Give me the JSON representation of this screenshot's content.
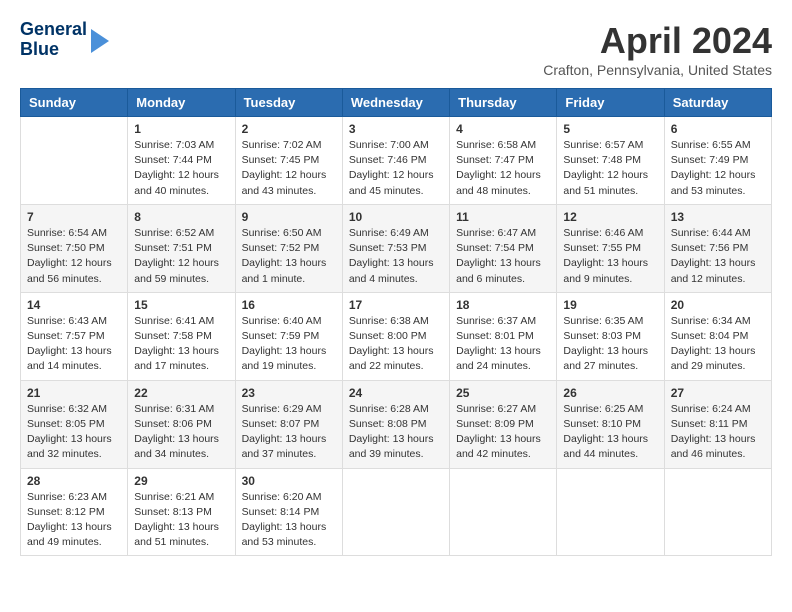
{
  "header": {
    "logo_line1": "General",
    "logo_line2": "Blue",
    "title": "April 2024",
    "subtitle": "Crafton, Pennsylvania, United States"
  },
  "days_of_week": [
    "Sunday",
    "Monday",
    "Tuesday",
    "Wednesday",
    "Thursday",
    "Friday",
    "Saturday"
  ],
  "weeks": [
    [
      {
        "day": "",
        "sunrise": "",
        "sunset": "",
        "daylight": ""
      },
      {
        "day": "1",
        "sunrise": "Sunrise: 7:03 AM",
        "sunset": "Sunset: 7:44 PM",
        "daylight": "Daylight: 12 hours and 40 minutes."
      },
      {
        "day": "2",
        "sunrise": "Sunrise: 7:02 AM",
        "sunset": "Sunset: 7:45 PM",
        "daylight": "Daylight: 12 hours and 43 minutes."
      },
      {
        "day": "3",
        "sunrise": "Sunrise: 7:00 AM",
        "sunset": "Sunset: 7:46 PM",
        "daylight": "Daylight: 12 hours and 45 minutes."
      },
      {
        "day": "4",
        "sunrise": "Sunrise: 6:58 AM",
        "sunset": "Sunset: 7:47 PM",
        "daylight": "Daylight: 12 hours and 48 minutes."
      },
      {
        "day": "5",
        "sunrise": "Sunrise: 6:57 AM",
        "sunset": "Sunset: 7:48 PM",
        "daylight": "Daylight: 12 hours and 51 minutes."
      },
      {
        "day": "6",
        "sunrise": "Sunrise: 6:55 AM",
        "sunset": "Sunset: 7:49 PM",
        "daylight": "Daylight: 12 hours and 53 minutes."
      }
    ],
    [
      {
        "day": "7",
        "sunrise": "Sunrise: 6:54 AM",
        "sunset": "Sunset: 7:50 PM",
        "daylight": "Daylight: 12 hours and 56 minutes."
      },
      {
        "day": "8",
        "sunrise": "Sunrise: 6:52 AM",
        "sunset": "Sunset: 7:51 PM",
        "daylight": "Daylight: 12 hours and 59 minutes."
      },
      {
        "day": "9",
        "sunrise": "Sunrise: 6:50 AM",
        "sunset": "Sunset: 7:52 PM",
        "daylight": "Daylight: 13 hours and 1 minute."
      },
      {
        "day": "10",
        "sunrise": "Sunrise: 6:49 AM",
        "sunset": "Sunset: 7:53 PM",
        "daylight": "Daylight: 13 hours and 4 minutes."
      },
      {
        "day": "11",
        "sunrise": "Sunrise: 6:47 AM",
        "sunset": "Sunset: 7:54 PM",
        "daylight": "Daylight: 13 hours and 6 minutes."
      },
      {
        "day": "12",
        "sunrise": "Sunrise: 6:46 AM",
        "sunset": "Sunset: 7:55 PM",
        "daylight": "Daylight: 13 hours and 9 minutes."
      },
      {
        "day": "13",
        "sunrise": "Sunrise: 6:44 AM",
        "sunset": "Sunset: 7:56 PM",
        "daylight": "Daylight: 13 hours and 12 minutes."
      }
    ],
    [
      {
        "day": "14",
        "sunrise": "Sunrise: 6:43 AM",
        "sunset": "Sunset: 7:57 PM",
        "daylight": "Daylight: 13 hours and 14 minutes."
      },
      {
        "day": "15",
        "sunrise": "Sunrise: 6:41 AM",
        "sunset": "Sunset: 7:58 PM",
        "daylight": "Daylight: 13 hours and 17 minutes."
      },
      {
        "day": "16",
        "sunrise": "Sunrise: 6:40 AM",
        "sunset": "Sunset: 7:59 PM",
        "daylight": "Daylight: 13 hours and 19 minutes."
      },
      {
        "day": "17",
        "sunrise": "Sunrise: 6:38 AM",
        "sunset": "Sunset: 8:00 PM",
        "daylight": "Daylight: 13 hours and 22 minutes."
      },
      {
        "day": "18",
        "sunrise": "Sunrise: 6:37 AM",
        "sunset": "Sunset: 8:01 PM",
        "daylight": "Daylight: 13 hours and 24 minutes."
      },
      {
        "day": "19",
        "sunrise": "Sunrise: 6:35 AM",
        "sunset": "Sunset: 8:03 PM",
        "daylight": "Daylight: 13 hours and 27 minutes."
      },
      {
        "day": "20",
        "sunrise": "Sunrise: 6:34 AM",
        "sunset": "Sunset: 8:04 PM",
        "daylight": "Daylight: 13 hours and 29 minutes."
      }
    ],
    [
      {
        "day": "21",
        "sunrise": "Sunrise: 6:32 AM",
        "sunset": "Sunset: 8:05 PM",
        "daylight": "Daylight: 13 hours and 32 minutes."
      },
      {
        "day": "22",
        "sunrise": "Sunrise: 6:31 AM",
        "sunset": "Sunset: 8:06 PM",
        "daylight": "Daylight: 13 hours and 34 minutes."
      },
      {
        "day": "23",
        "sunrise": "Sunrise: 6:29 AM",
        "sunset": "Sunset: 8:07 PM",
        "daylight": "Daylight: 13 hours and 37 minutes."
      },
      {
        "day": "24",
        "sunrise": "Sunrise: 6:28 AM",
        "sunset": "Sunset: 8:08 PM",
        "daylight": "Daylight: 13 hours and 39 minutes."
      },
      {
        "day": "25",
        "sunrise": "Sunrise: 6:27 AM",
        "sunset": "Sunset: 8:09 PM",
        "daylight": "Daylight: 13 hours and 42 minutes."
      },
      {
        "day": "26",
        "sunrise": "Sunrise: 6:25 AM",
        "sunset": "Sunset: 8:10 PM",
        "daylight": "Daylight: 13 hours and 44 minutes."
      },
      {
        "day": "27",
        "sunrise": "Sunrise: 6:24 AM",
        "sunset": "Sunset: 8:11 PM",
        "daylight": "Daylight: 13 hours and 46 minutes."
      }
    ],
    [
      {
        "day": "28",
        "sunrise": "Sunrise: 6:23 AM",
        "sunset": "Sunset: 8:12 PM",
        "daylight": "Daylight: 13 hours and 49 minutes."
      },
      {
        "day": "29",
        "sunrise": "Sunrise: 6:21 AM",
        "sunset": "Sunset: 8:13 PM",
        "daylight": "Daylight: 13 hours and 51 minutes."
      },
      {
        "day": "30",
        "sunrise": "Sunrise: 6:20 AM",
        "sunset": "Sunset: 8:14 PM",
        "daylight": "Daylight: 13 hours and 53 minutes."
      },
      {
        "day": "",
        "sunrise": "",
        "sunset": "",
        "daylight": ""
      },
      {
        "day": "",
        "sunrise": "",
        "sunset": "",
        "daylight": ""
      },
      {
        "day": "",
        "sunrise": "",
        "sunset": "",
        "daylight": ""
      },
      {
        "day": "",
        "sunrise": "",
        "sunset": "",
        "daylight": ""
      }
    ]
  ]
}
